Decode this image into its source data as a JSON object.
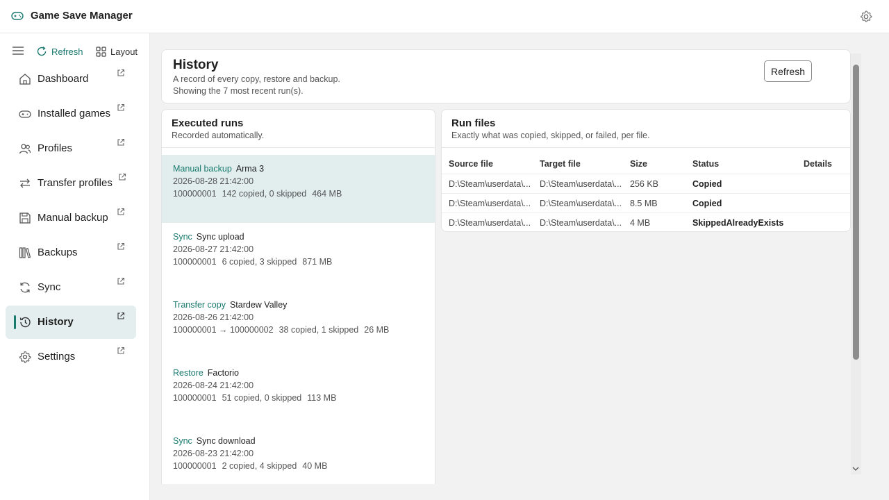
{
  "app": {
    "title": "Game Save Manager"
  },
  "toolbar": {
    "refresh_label": "Refresh",
    "layout_label": "Layout"
  },
  "sidebar": {
    "items": [
      {
        "label": "Dashboard",
        "icon": "home-icon"
      },
      {
        "label": "Installed games",
        "icon": "gamepad-icon"
      },
      {
        "label": "Profiles",
        "icon": "people-icon"
      },
      {
        "label": "Transfer profiles",
        "icon": "transfer-icon"
      },
      {
        "label": "Manual backup",
        "icon": "save-icon"
      },
      {
        "label": "Backups",
        "icon": "library-icon"
      },
      {
        "label": "Sync",
        "icon": "sync-icon"
      },
      {
        "label": "History",
        "icon": "history-icon",
        "active": true
      },
      {
        "label": "Settings",
        "icon": "gear-icon"
      }
    ]
  },
  "history": {
    "title": "History",
    "subtitle": "A record of every copy, restore and backup.",
    "count_text": "Showing the 7 most recent run(s).",
    "refresh_label": "Refresh"
  },
  "runs": {
    "title": "Executed runs",
    "subtitle": "Recorded automatically.",
    "items": [
      {
        "type": "Manual backup",
        "name": "Arma 3",
        "date": "2026-08-28 21:42:00",
        "ids": "100000001",
        "counts": "142 copied, 0 skipped",
        "size": "464 MB",
        "selected": true
      },
      {
        "type": "Sync",
        "name": "Sync upload",
        "date": "2026-08-27 21:42:00",
        "ids": "100000001",
        "counts": "6 copied, 3 skipped",
        "size": "871 MB"
      },
      {
        "type": "Transfer copy",
        "name": "Stardew Valley",
        "date": "2026-08-26 21:42:00",
        "ids": "100000001 → 100000002",
        "counts": "38 copied, 1 skipped",
        "size": "26 MB"
      },
      {
        "type": "Restore",
        "name": "Factorio",
        "date": "2026-08-24 21:42:00",
        "ids": "100000001",
        "counts": "51 copied, 0 skipped",
        "size": "113 MB"
      },
      {
        "type": "Sync",
        "name": "Sync download",
        "date": "2026-08-23 21:42:00",
        "ids": "100000001",
        "counts": "2 copied, 4 skipped",
        "size": "40 MB"
      }
    ]
  },
  "files": {
    "title": "Run files",
    "subtitle": "Exactly what was copied, skipped, or failed, per file.",
    "columns": [
      "Source file",
      "Target file",
      "Size",
      "Status",
      "Details"
    ],
    "rows": [
      {
        "source": "D:\\Steam\\userdata\\...",
        "target": "D:\\Steam\\userdata\\...",
        "size": "256 KB",
        "status": "Copied",
        "details": ""
      },
      {
        "source": "D:\\Steam\\userdata\\...",
        "target": "D:\\Steam\\userdata\\...",
        "size": "8.5 MB",
        "status": "Copied",
        "details": ""
      },
      {
        "source": "D:\\Steam\\userdata\\...",
        "target": "D:\\Steam\\userdata\\...",
        "size": "4 MB",
        "status": "SkippedAlreadyExists",
        "details": ""
      }
    ]
  },
  "colors": {
    "accent": "#1a7a6e",
    "selected_bg": "#e2eeee",
    "nav_active_bg": "#e4eeee"
  }
}
